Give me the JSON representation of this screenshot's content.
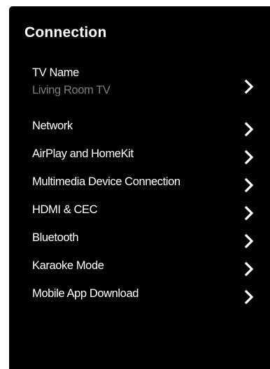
{
  "page": {
    "title": "Connection"
  },
  "menu": {
    "items": [
      {
        "label": "TV Name",
        "sublabel": "Living Room TV"
      },
      {
        "label": "Network"
      },
      {
        "label": "AirPlay and HomeKit"
      },
      {
        "label": "Multimedia Device Connection"
      },
      {
        "label": "HDMI & CEC"
      },
      {
        "label": "Bluetooth"
      },
      {
        "label": "Karaoke Mode"
      },
      {
        "label": "Mobile App Download"
      }
    ]
  },
  "icons": {
    "chevron": "chevron-right-icon"
  },
  "colors": {
    "panel_background": "#000000",
    "text_primary": "#ffffff",
    "text_secondary": "#7f7f7f",
    "page_background": "#ffffff"
  }
}
